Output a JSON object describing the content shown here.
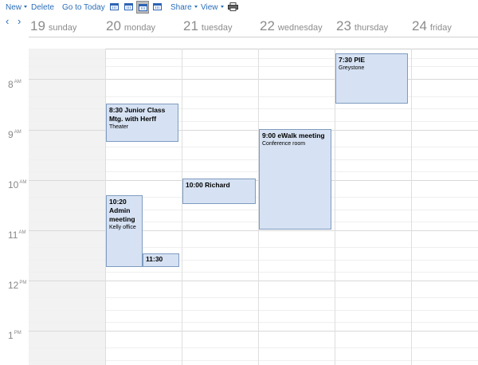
{
  "toolbar": {
    "new_label": "New",
    "delete_label": "Delete",
    "today_label": "Go to Today",
    "share_label": "Share",
    "view_label": "View",
    "view_icons": [
      "day-view-icon",
      "work-week-view-icon",
      "week-view-icon",
      "month-view-icon"
    ],
    "selected_view": "week-view-icon"
  },
  "nav": {
    "prev": "‹",
    "next": "›"
  },
  "days": [
    {
      "num": "19",
      "name": "sunday"
    },
    {
      "num": "20",
      "name": "monday"
    },
    {
      "num": "21",
      "name": "tuesday"
    },
    {
      "num": "22",
      "name": "wednesday"
    },
    {
      "num": "23",
      "name": "thursday"
    },
    {
      "num": "24",
      "name": "friday"
    }
  ],
  "hours": [
    {
      "h": "8",
      "ap": "AM"
    },
    {
      "h": "9",
      "ap": "AM"
    },
    {
      "h": "10",
      "ap": "AM"
    },
    {
      "h": "11",
      "ap": "AM"
    },
    {
      "h": "12",
      "ap": "PM"
    },
    {
      "h": "1",
      "ap": "PM"
    }
  ],
  "events": [
    {
      "title": "7:30 PIE",
      "location": "Greystone",
      "day": "thursday",
      "start": "7:30",
      "end": "8:30"
    },
    {
      "title": "8:30 Junior Class Mtg. with Herff",
      "location": "Theater",
      "day": "monday",
      "start": "8:30",
      "end": "9:15"
    },
    {
      "title": "9:00 eWalk meeting",
      "location": "Conference room",
      "day": "wednesday",
      "start": "9:00",
      "end": "11:00"
    },
    {
      "title": "10:00 Richard",
      "location": "",
      "day": "tuesday",
      "start": "10:00",
      "end": "10:30"
    },
    {
      "title": "10:20 Admin meeting",
      "location": "Kelly office",
      "day": "monday",
      "start": "10:20",
      "end": "11:40"
    },
    {
      "title": "11:30",
      "location": "",
      "day": "monday",
      "start": "11:30",
      "end": "11:45"
    }
  ],
  "colors": {
    "link": "#2a6eb8",
    "event_fill": "#d6e2f3",
    "event_border": "#7f9bbf",
    "day_header_text": "#8c8c8c"
  }
}
